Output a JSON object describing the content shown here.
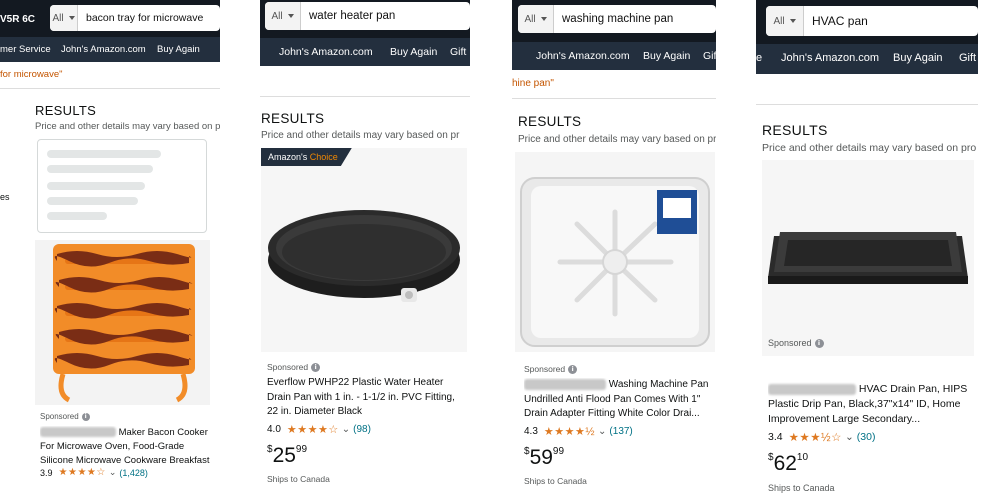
{
  "panels": [
    {
      "search": {
        "category": "All",
        "query": "bacon tray for microwave"
      },
      "location": "V5R 6C",
      "nav": [
        "mer Service",
        "John's Amazon.com",
        "Buy Again"
      ],
      "refinement": "for microwave\"",
      "sidebar_fragment": "es",
      "results_heading": "RESULTS",
      "results_note": "Price and other details may vary based on pro",
      "product": {
        "sponsored": "Sponsored",
        "title": "Maker Bacon Cooker For Microwave Oven, Food-Grade Silicone Microwave Cookware Breakfast Maker...",
        "rating": "3.9",
        "stars": "★★★★☆",
        "count": "(1,428)"
      }
    },
    {
      "search": {
        "category": "All",
        "query": "water heater pan"
      },
      "nav": [
        "John's Amazon.com",
        "Buy Again",
        "Gift"
      ],
      "results_heading": "RESULTS",
      "results_note": "Price and other details may vary based on pr",
      "product": {
        "badge_left": "Amazon's",
        "badge_right": "Choice",
        "sponsored": "Sponsored",
        "title": "Everflow PWHP22 Plastic Water Heater Drain Pan with 1 in. - 1-1/2 in. PVC Fitting, 22 in. Diameter Black",
        "rating": "4.0",
        "stars": "★★★★☆",
        "count": "(98)",
        "price_symbol": "$",
        "price_whole": "25",
        "price_cents": "99",
        "ships": "Ships to Canada"
      }
    },
    {
      "search": {
        "category": "All",
        "query": "washing machine pan"
      },
      "nav": [
        "John's Amazon.com",
        "Buy Again",
        "Gif"
      ],
      "refinement": "hine pan\"",
      "results_heading": "RESULTS",
      "results_note": "Price and other details may vary based on pr",
      "product": {
        "sponsored": "Sponsored",
        "title": "Washing Machine Pan Undrilled Anti Flood Pan Comes With 1\" Drain Adapter Fitting White Color Drai...",
        "rating": "4.3",
        "stars": "★★★★½",
        "count": "(137)",
        "price_symbol": "$",
        "price_whole": "59",
        "price_cents": "99",
        "ships": "Ships to Canada"
      }
    },
    {
      "search": {
        "category": "All",
        "query": "HVAC pan"
      },
      "nav": [
        "John's Amazon.com",
        "Buy Again",
        "Gift"
      ],
      "results_heading": "RESULTS",
      "results_note": "Price and other details may vary based on pro",
      "product": {
        "sponsored": "Sponsored",
        "title": "HVAC Drain Pan, HIPS Plastic Drip Pan, Black,37\"x14\" ID, Home Improvement Large Secondary...",
        "rating": "3.4",
        "stars": "★★★½☆",
        "count": "(30)",
        "price_symbol": "$",
        "price_whole": "62",
        "price_cents": "10",
        "ships": "Ships to Canada"
      }
    }
  ],
  "colors": {
    "header": "#131921",
    "subnav": "#232f3e",
    "star": "#de7921",
    "link": "#007185",
    "refinement": "#c45500",
    "choice_accent": "#f08804"
  }
}
